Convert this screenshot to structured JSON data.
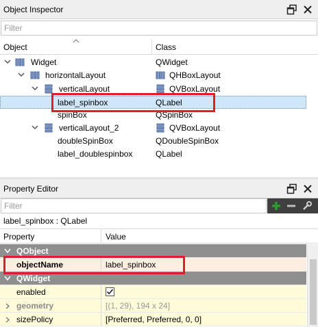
{
  "object_inspector": {
    "title": "Object Inspector",
    "filter_placeholder": "Filter",
    "col_object": "Object",
    "col_class": "Class",
    "rows": [
      {
        "object": "Widget",
        "class": "QWidget",
        "icon": "form-layout-icon"
      },
      {
        "object": "horizontalLayout",
        "class": "QHBoxLayout",
        "icon": "hbox-layout-icon"
      },
      {
        "object": "verticalLayout",
        "class": "QVBoxLayout",
        "icon": "vbox-layout-icon"
      },
      {
        "object": "label_spinbox",
        "class": "QLabel",
        "icon": ""
      },
      {
        "object": "spinBox",
        "class": "QSpinBox",
        "icon": ""
      },
      {
        "object": "verticalLayout_2",
        "class": "QVBoxLayout",
        "icon": "vbox-layout-icon"
      },
      {
        "object": "doubleSpinBox",
        "class": "QDoubleSpinBox",
        "icon": ""
      },
      {
        "object": "label_doublespinbox",
        "class": "QLabel",
        "icon": ""
      }
    ]
  },
  "property_editor": {
    "title": "Property Editor",
    "filter_placeholder": "Filter",
    "context": "label_spinbox : QLabel",
    "col_property": "Property",
    "col_value": "Value",
    "rows": [
      {
        "type": "group",
        "name": "QObject"
      },
      {
        "type": "prop",
        "name": "objectName",
        "value": "label_spinbox"
      },
      {
        "type": "group",
        "name": "QWidget"
      },
      {
        "type": "prop",
        "name": "enabled",
        "value": ""
      },
      {
        "type": "prop",
        "name": "geometry",
        "value": "[(1, 29), 194 x 24]"
      },
      {
        "type": "prop",
        "name": "sizePolicy",
        "value": "[Preferred, Preferred, 0, 0]"
      }
    ]
  },
  "colors": {
    "highlight_red": "#e11d2b",
    "selection_blue": "#cfe6fb",
    "group_gray": "#8f8f8f",
    "qobject_row": "#fdeee2",
    "qwidget_row": "#fefbd9",
    "add_green": "#2e9b2e"
  }
}
